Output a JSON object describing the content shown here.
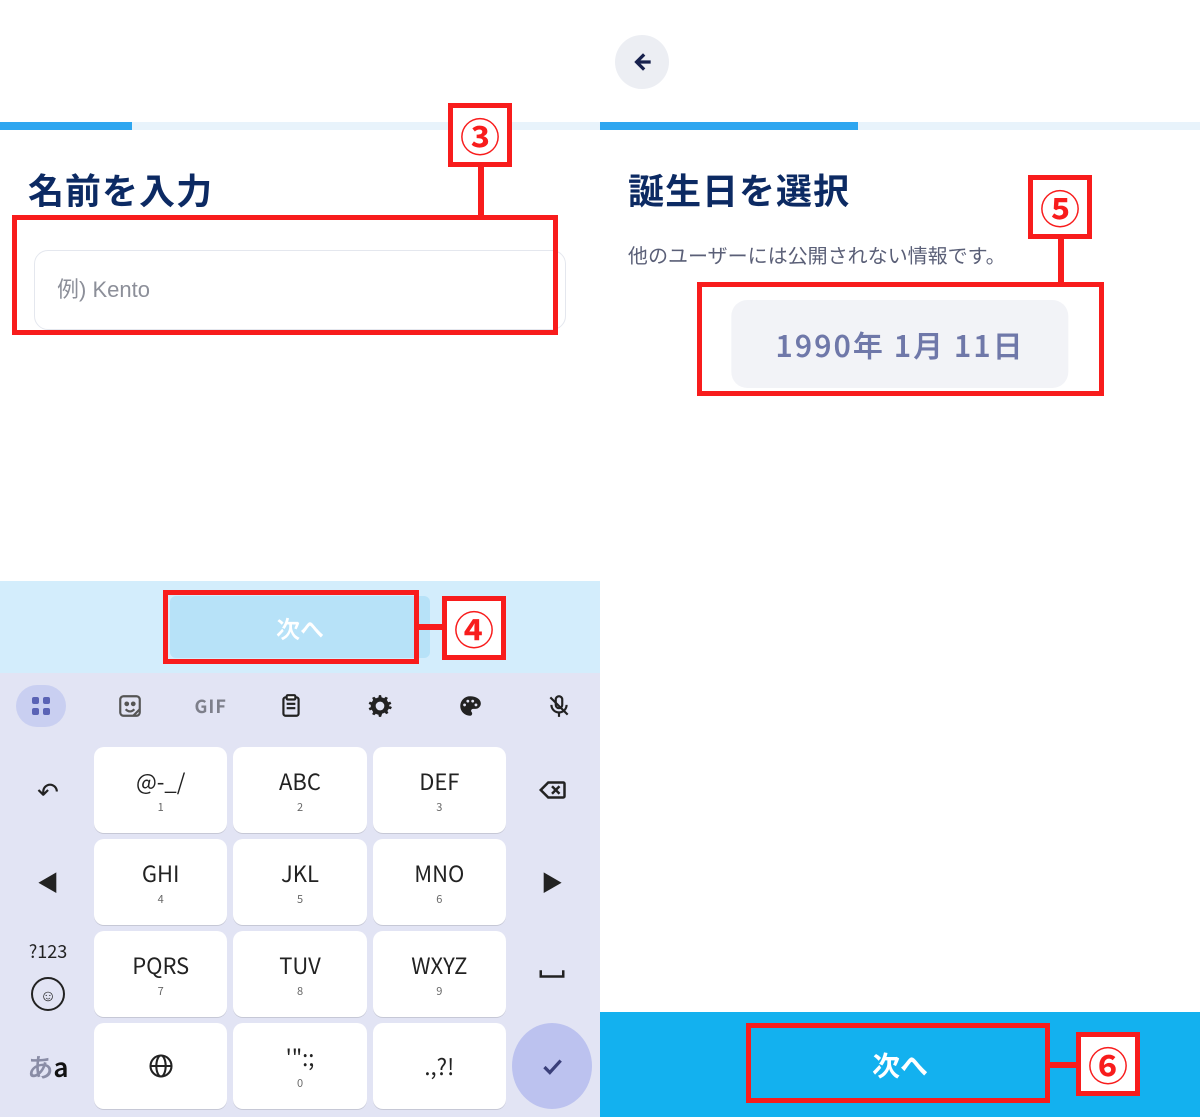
{
  "left": {
    "title": "名前を入力",
    "name_placeholder": "例) Kento",
    "next_label": "次へ",
    "keyboard": {
      "toolbar": {
        "apps_icon": "apps",
        "sticker_icon": "sticker",
        "gif_label": "GIF",
        "clipboard_icon": "clipboard",
        "settings_icon": "settings",
        "palette_icon": "palette",
        "mic_off_icon": "mic-off"
      },
      "rows": [
        {
          "left": "↶",
          "k1": {
            "main": "@-_/",
            "sub": "1"
          },
          "k2": {
            "main": "ABC",
            "sub": "2"
          },
          "k3": {
            "main": "DEF",
            "sub": "3"
          },
          "right": "backspace"
        },
        {
          "left": "◀",
          "k1": {
            "main": "GHI",
            "sub": "4"
          },
          "k2": {
            "main": "JKL",
            "sub": "5"
          },
          "k3": {
            "main": "MNO",
            "sub": "6"
          },
          "right": "▶"
        },
        {
          "left_top": "?123",
          "left_bot": "☺",
          "k1": {
            "main": "PQRS",
            "sub": "7"
          },
          "k2": {
            "main": "TUV",
            "sub": "8"
          },
          "k3": {
            "main": "WXYZ",
            "sub": "9"
          },
          "right": "␣"
        },
        {
          "left": {
            "ja": "あ",
            "en": "a"
          },
          "k1": {
            "main": "⊕",
            "sub": ""
          },
          "k2": {
            "main": "'\":;",
            "sub": "0"
          },
          "k3": {
            "main": ".,?!",
            "sub": ""
          },
          "right": "✓"
        }
      ]
    }
  },
  "right": {
    "title": "誕生日を選択",
    "subtitle": "他のユーザーには公開されない情報です。",
    "date_value": "1990年 1月 11日",
    "next_label": "次へ"
  },
  "annotations": {
    "b3": "③",
    "b4": "④",
    "b5": "⑤",
    "b6": "⑥"
  }
}
